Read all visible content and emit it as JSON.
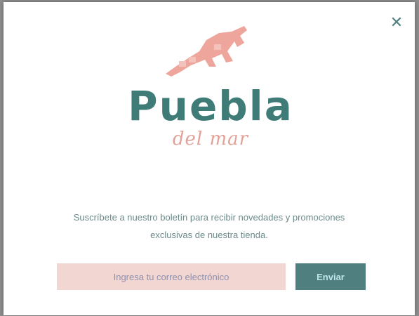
{
  "modal": {
    "close_icon": "close-icon",
    "close_glyph": "✕",
    "brand": {
      "name": "Puebla",
      "subtitle": "del mar",
      "icon": "kangaroo-logo-icon"
    },
    "message": {
      "line1": "Suscríbete a nuestro boletín para recibir novedades y promociones",
      "line2": "exclusivas de nuestra tienda."
    },
    "form": {
      "email_placeholder": "Ingresa tu correo electrónico",
      "submit_label": "Enviar"
    }
  },
  "colors": {
    "brand_teal": "#3f7c78",
    "brand_pink": "#e2a298",
    "input_bg": "#f2d6d2",
    "button_bg": "#4f7f7f"
  }
}
